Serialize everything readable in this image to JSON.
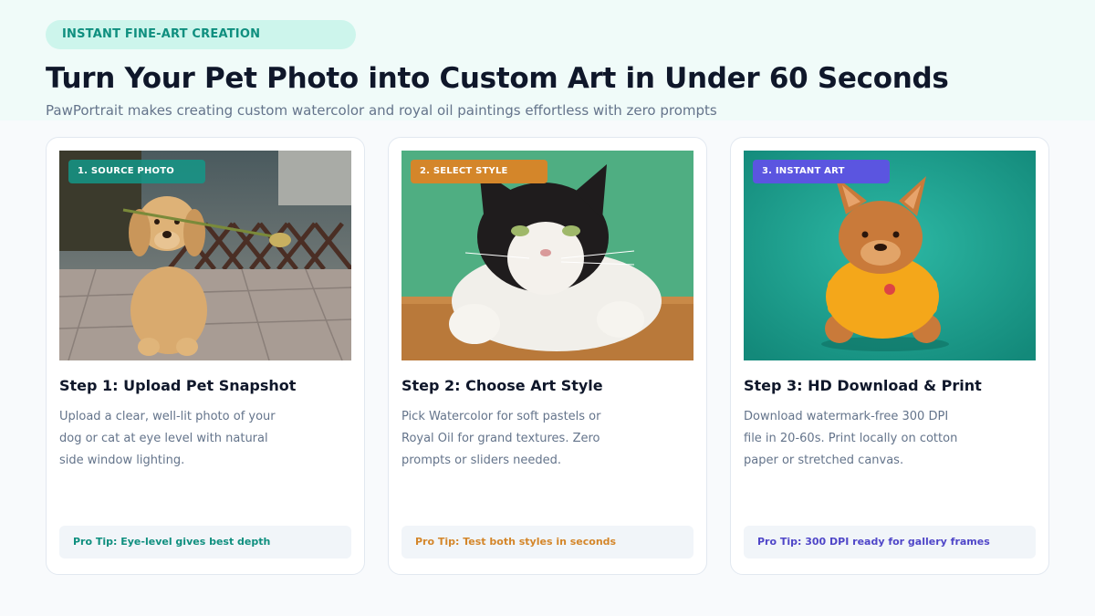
{
  "header": {
    "pill_label": "INSTANT FINE-ART CREATION",
    "title": "Turn Your Pet Photo into Custom Art in Under 60 Seconds",
    "subtitle": "PawPortrait makes creating custom watercolor and royal oil paintings effortless with zero prompts"
  },
  "steps": [
    {
      "badge": "1. SOURCE PHOTO",
      "title": "Step 1: Upload Pet Snapshot",
      "body": "Upload a clear, well-lit photo of your dog or cat at eye level with natural side window lighting.",
      "tip": "Pro Tip: Eye-level gives best depth",
      "photo": "golden-retriever-puppy-with-flower"
    },
    {
      "badge": "2. SELECT STYLE",
      "title": "Step 2: Choose Art Style",
      "body": "Pick Watercolor for soft pastels or Royal Oil for grand textures. Zero prompts or sliders needed.",
      "tip": "Pro Tip: Test both styles in seconds",
      "photo": "black-and-white-cat-on-table"
    },
    {
      "badge": "3. INSTANT ART",
      "title": "Step 3: HD Download & Print",
      "body": "Download watermark-free 300 DPI file in 20-60s. Print locally on cotton paper or stretched canvas.",
      "tip": "Pro Tip: 300 DPI ready for gallery frames",
      "photo": "french-bulldog-in-yellow-shirt-painting"
    }
  ],
  "colors": {
    "teal": "#0f8f7f",
    "orange": "#d4862a",
    "indigo": "#5b55e0",
    "title": "#0f172a",
    "muted": "#64748b"
  }
}
